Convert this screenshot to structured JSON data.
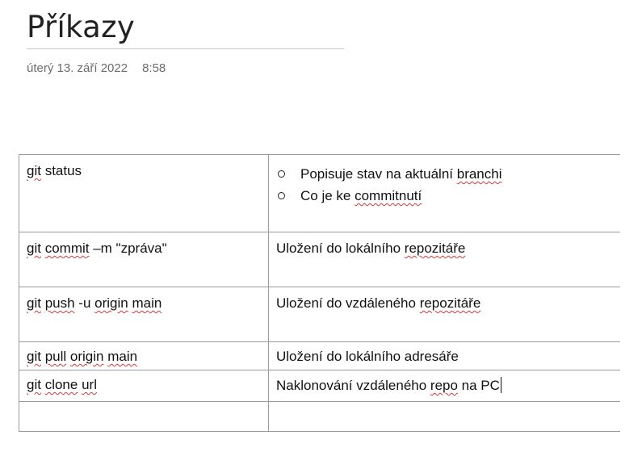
{
  "page": {
    "title": "Příkazy",
    "date": "úterý 13. září 2022",
    "time": "8:58"
  },
  "table": {
    "rows": [
      {
        "command_parts": [
          "git",
          " status"
        ],
        "description_bullets": [
          "Popisuje stav na aktuální ",
          "branchi",
          "Co je ke ",
          "commitnutí"
        ]
      },
      {
        "command": "git commit –m \"zpráva\"",
        "description": "Uložení do lokálního repozitáře"
      },
      {
        "command": "git push -u origin main",
        "description": "Uložení do vzdáleného repozitáře"
      },
      {
        "command": "git pull origin main",
        "description": "Uložení do lokálního adresáře"
      },
      {
        "command": "git clone  url",
        "description": "Naklonování vzdáleného repo na PC"
      },
      {
        "command": "",
        "description": ""
      }
    ]
  },
  "text": {
    "r1_cmd_a": "git",
    "r1_cmd_b": " status",
    "r1_b1_a": "Popisuje stav na aktuální ",
    "r1_b1_b": "branchi",
    "r1_b2_a": "Co je ke ",
    "r1_b2_b": "commitnutí",
    "r2_cmd_a": "git",
    "r2_cmd_b": " ",
    "r2_cmd_c": "commit",
    "r2_cmd_d": " –m \"zpráva\"",
    "r2_desc_a": "Uložení do lokálního ",
    "r2_desc_b": "repozitáře",
    "r3_cmd_a": "git",
    "r3_cmd_b": " ",
    "r3_cmd_c": "push",
    "r3_cmd_d": " -u ",
    "r3_cmd_e": "origin",
    "r3_cmd_f": " ",
    "r3_cmd_g": "main",
    "r3_desc_a": "Uložení do vzdáleného ",
    "r3_desc_b": "repozitáře",
    "r4_cmd_a": "git",
    "r4_cmd_b": " ",
    "r4_cmd_c": "pull",
    "r4_cmd_d": " ",
    "r4_cmd_e": "origin",
    "r4_cmd_f": " ",
    "r4_cmd_g": "main",
    "r4_desc": "Uložení do lokálního adresáře",
    "r5_cmd_a": "git",
    "r5_cmd_b": " ",
    "r5_cmd_c": "clone",
    "r5_cmd_d": "  ",
    "r5_cmd_e": "url",
    "r5_desc_a": "Naklonování vzdáleného ",
    "r5_desc_b": "repo",
    "r5_desc_c": " na PC"
  },
  "colors": {
    "spellcheck_underline": "#d23a3a",
    "table_border": "#9a9a9a",
    "meta_text": "#6b6b6b"
  }
}
